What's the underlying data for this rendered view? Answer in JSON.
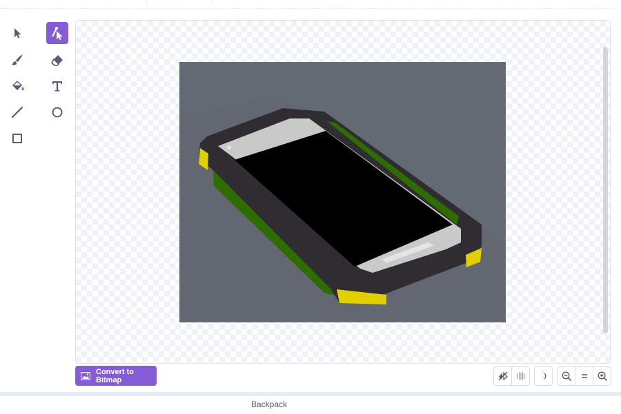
{
  "tools": [
    {
      "name": "select-tool",
      "icon": "arrow-select-icon",
      "selected": false
    },
    {
      "name": "reshape-tool",
      "icon": "reshape-icon",
      "selected": true
    },
    {
      "name": "brush-tool",
      "icon": "brush-icon",
      "selected": false
    },
    {
      "name": "eraser-tool",
      "icon": "eraser-icon",
      "selected": false
    },
    {
      "name": "fill-tool",
      "icon": "fill-bucket-icon",
      "selected": false
    },
    {
      "name": "text-tool",
      "icon": "text-icon",
      "selected": false
    },
    {
      "name": "line-tool",
      "icon": "line-icon",
      "selected": false
    },
    {
      "name": "circle-tool",
      "icon": "circle-icon",
      "selected": false
    },
    {
      "name": "rectangle-tool",
      "icon": "rectangle-icon",
      "selected": false
    }
  ],
  "canvas": {
    "costume": "phone-image",
    "colors": {
      "background": "#646a74",
      "case": "#2f2d32",
      "screen": "#000000",
      "bezel": "#c9cbc9",
      "side": "#2e6a00",
      "bumper": "#e2cf00"
    }
  },
  "convert_button": {
    "label": "Convert to Bitmap",
    "icon": "image-icon"
  },
  "controls": {
    "icons": [
      "flip-horizontal-icon",
      "flip-vertical-icon",
      "dark-mode-icon",
      "zoom-out-icon",
      "zoom-reset-icon",
      "zoom-in-icon"
    ]
  },
  "backpack": {
    "label": "Backpack"
  },
  "accent_color": "#855cd6"
}
